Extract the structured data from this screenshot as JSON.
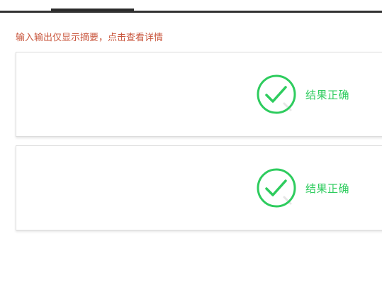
{
  "notice": {
    "text": "输入输出仅显示摘要，点击查看详情"
  },
  "results": [
    {
      "status_icon": "check-circle-icon",
      "status_label": "结果正确",
      "status_color": "#2ecc5e"
    },
    {
      "status_icon": "check-circle-icon",
      "status_label": "结果正确",
      "status_color": "#2ecc5e"
    }
  ]
}
